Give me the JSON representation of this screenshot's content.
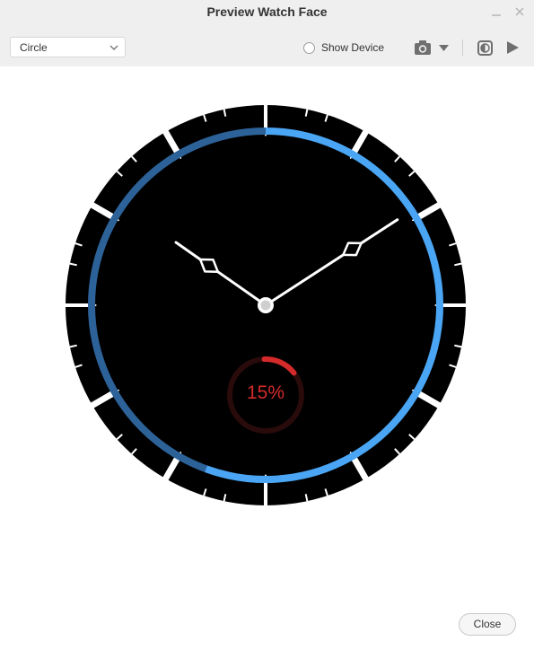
{
  "window": {
    "title": "Preview Watch Face"
  },
  "toolbar": {
    "shape_select": {
      "value": "Circle"
    },
    "show_device": {
      "label": "Show Device",
      "checked": false
    }
  },
  "watch_face": {
    "progress_percent": 15,
    "progress_label": "15%",
    "colors": {
      "ring_bright": "#4aa6f4",
      "ring_dark": "#2d6299",
      "progress": "#d42a2a",
      "hands": "#ffffff",
      "dial": "#000000"
    },
    "hands": {
      "hour_hand_time": "10:10",
      "minute_hand_points_to_minute": 9.5
    }
  },
  "footer": {
    "close_label": "Close"
  }
}
